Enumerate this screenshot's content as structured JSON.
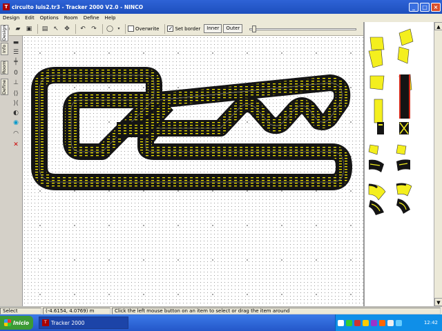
{
  "window": {
    "title": "circuito luis2.tr3 - Tracker 2000 V2.0 - NINCO",
    "app_icon_text": "T"
  },
  "menu": [
    "Design",
    "Edit",
    "Options",
    "Room",
    "Define",
    "Help"
  ],
  "toolbar": {
    "overwrite_label": "Overwrite",
    "overwrite_checked": false,
    "set_border_label": "Set border",
    "set_border_checked": true,
    "inner_label": "Inner",
    "outer_label": "Outer"
  },
  "left_tabs": [
    "Design",
    "Info",
    "Room",
    "Define"
  ],
  "status": {
    "mode": "Select",
    "coords": "(-4.6154, 4.0769) m",
    "hint": "Click the left mouse button on an item to select or drag the item around"
  },
  "taskbar": {
    "start_label": "Inicio",
    "task_label": "Tracker 2000",
    "clock": "12:42"
  },
  "colors": {
    "track": "#141414",
    "lane_marks": "#f2e600",
    "piece_yellow": "#f4ef1e",
    "border_stripe": "#d12a1a",
    "titlebar": "#2e63d6"
  },
  "icons": [
    "new-file-icon",
    "open-folder-icon",
    "save-icon",
    "print-icon",
    "pointer-icon",
    "move-icon",
    "undo-icon",
    "redo-icon",
    "circle-tool-icon",
    "minimize-icon",
    "maximize-icon",
    "close-icon"
  ]
}
